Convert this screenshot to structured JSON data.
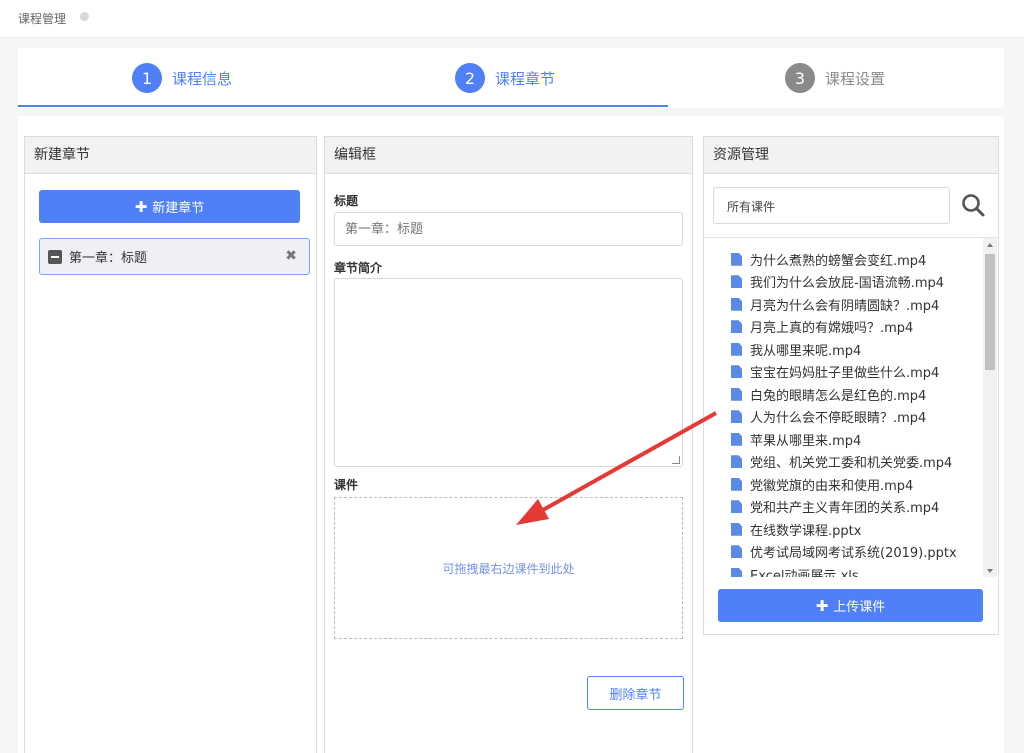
{
  "breadcrumb": "课程管理",
  "steps": [
    {
      "num": "1",
      "label": "课程信息"
    },
    {
      "num": "2",
      "label": "课程章节"
    },
    {
      "num": "3",
      "label": "课程设置"
    }
  ],
  "new_chapter_panel": {
    "title": "新建章节",
    "button": "新建章节",
    "chapter_item": "第一章：标题"
  },
  "editor_panel": {
    "title": "编辑框",
    "title_label": "标题",
    "title_placeholder": "第一章：标题",
    "intro_label": "章节简介",
    "courseware_label": "课件",
    "dropzone_text": "可拖拽最右边课件到此处",
    "delete_button": "删除章节"
  },
  "resource_panel": {
    "title": "资源管理",
    "search_value": "所有课件",
    "files": [
      "为什么煮熟的螃蟹会变红.mp4",
      "我们为什么会放屁-国语流畅.mp4",
      "月亮为什么会有阴晴圆缺？.mp4",
      "月亮上真的有嫦娥吗？.mp4",
      "我从哪里来呢.mp4",
      "宝宝在妈妈肚子里做些什么.mp4",
      "白兔的眼睛怎么是红色的.mp4",
      "人为什么会不停眨眼睛？.mp4",
      "苹果从哪里来.mp4",
      "党组、机关党工委和机关党委.mp4",
      "党徽党旗的由来和使用.mp4",
      "党和共产主义青年团的关系.mp4",
      "在线数学课程.pptx",
      "优考试局域网考试系统(2019).pptx",
      "Excel动画展示.xls"
    ],
    "upload_button": "上传课件"
  }
}
